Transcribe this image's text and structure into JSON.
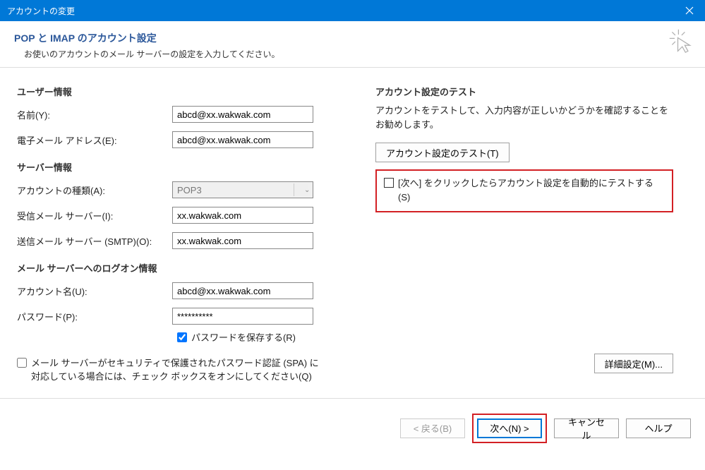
{
  "titlebar": {
    "title": "アカウントの変更"
  },
  "header": {
    "heading": "POP と IMAP のアカウント設定",
    "sub": "お使いのアカウントのメール サーバーの設定を入力してください。"
  },
  "sections": {
    "user_info": {
      "title": "ユーザー情報",
      "name_label": "名前(Y):",
      "name_value": "abcd@xx.wakwak.com",
      "email_label": "電子メール アドレス(E):",
      "email_value": "abcd@xx.wakwak.com"
    },
    "server_info": {
      "title": "サーバー情報",
      "acct_type_label": "アカウントの種類(A):",
      "acct_type_value": "POP3",
      "incoming_label": "受信メール サーバー(I):",
      "incoming_value": "xx.wakwak.com",
      "outgoing_label": "送信メール サーバー (SMTP)(O):",
      "outgoing_value": "xx.wakwak.com"
    },
    "logon_info": {
      "title": "メール サーバーへのログオン情報",
      "acct_name_label": "アカウント名(U):",
      "acct_name_value": "abcd@xx.wakwak.com",
      "password_label": "パスワード(P):",
      "password_value": "**********",
      "remember_label": "パスワードを保存する(R)",
      "spa_label": "メール サーバーがセキュリティで保護されたパスワード認証 (SPA) に対応している場合には、チェック ボックスをオンにしてください(Q)"
    },
    "test": {
      "title": "アカウント設定のテスト",
      "desc": "アカウントをテストして、入力内容が正しいかどうかを確認することをお勧めします。",
      "test_button": "アカウント設定のテスト(T)",
      "auto_test_label": "[次へ] をクリックしたらアカウント設定を自動的にテストする(S)"
    },
    "advanced_button": "詳細設定(M)..."
  },
  "footer": {
    "back": "< 戻る(B)",
    "next": "次へ(N) >",
    "cancel": "キャンセル",
    "help": "ヘルプ"
  }
}
